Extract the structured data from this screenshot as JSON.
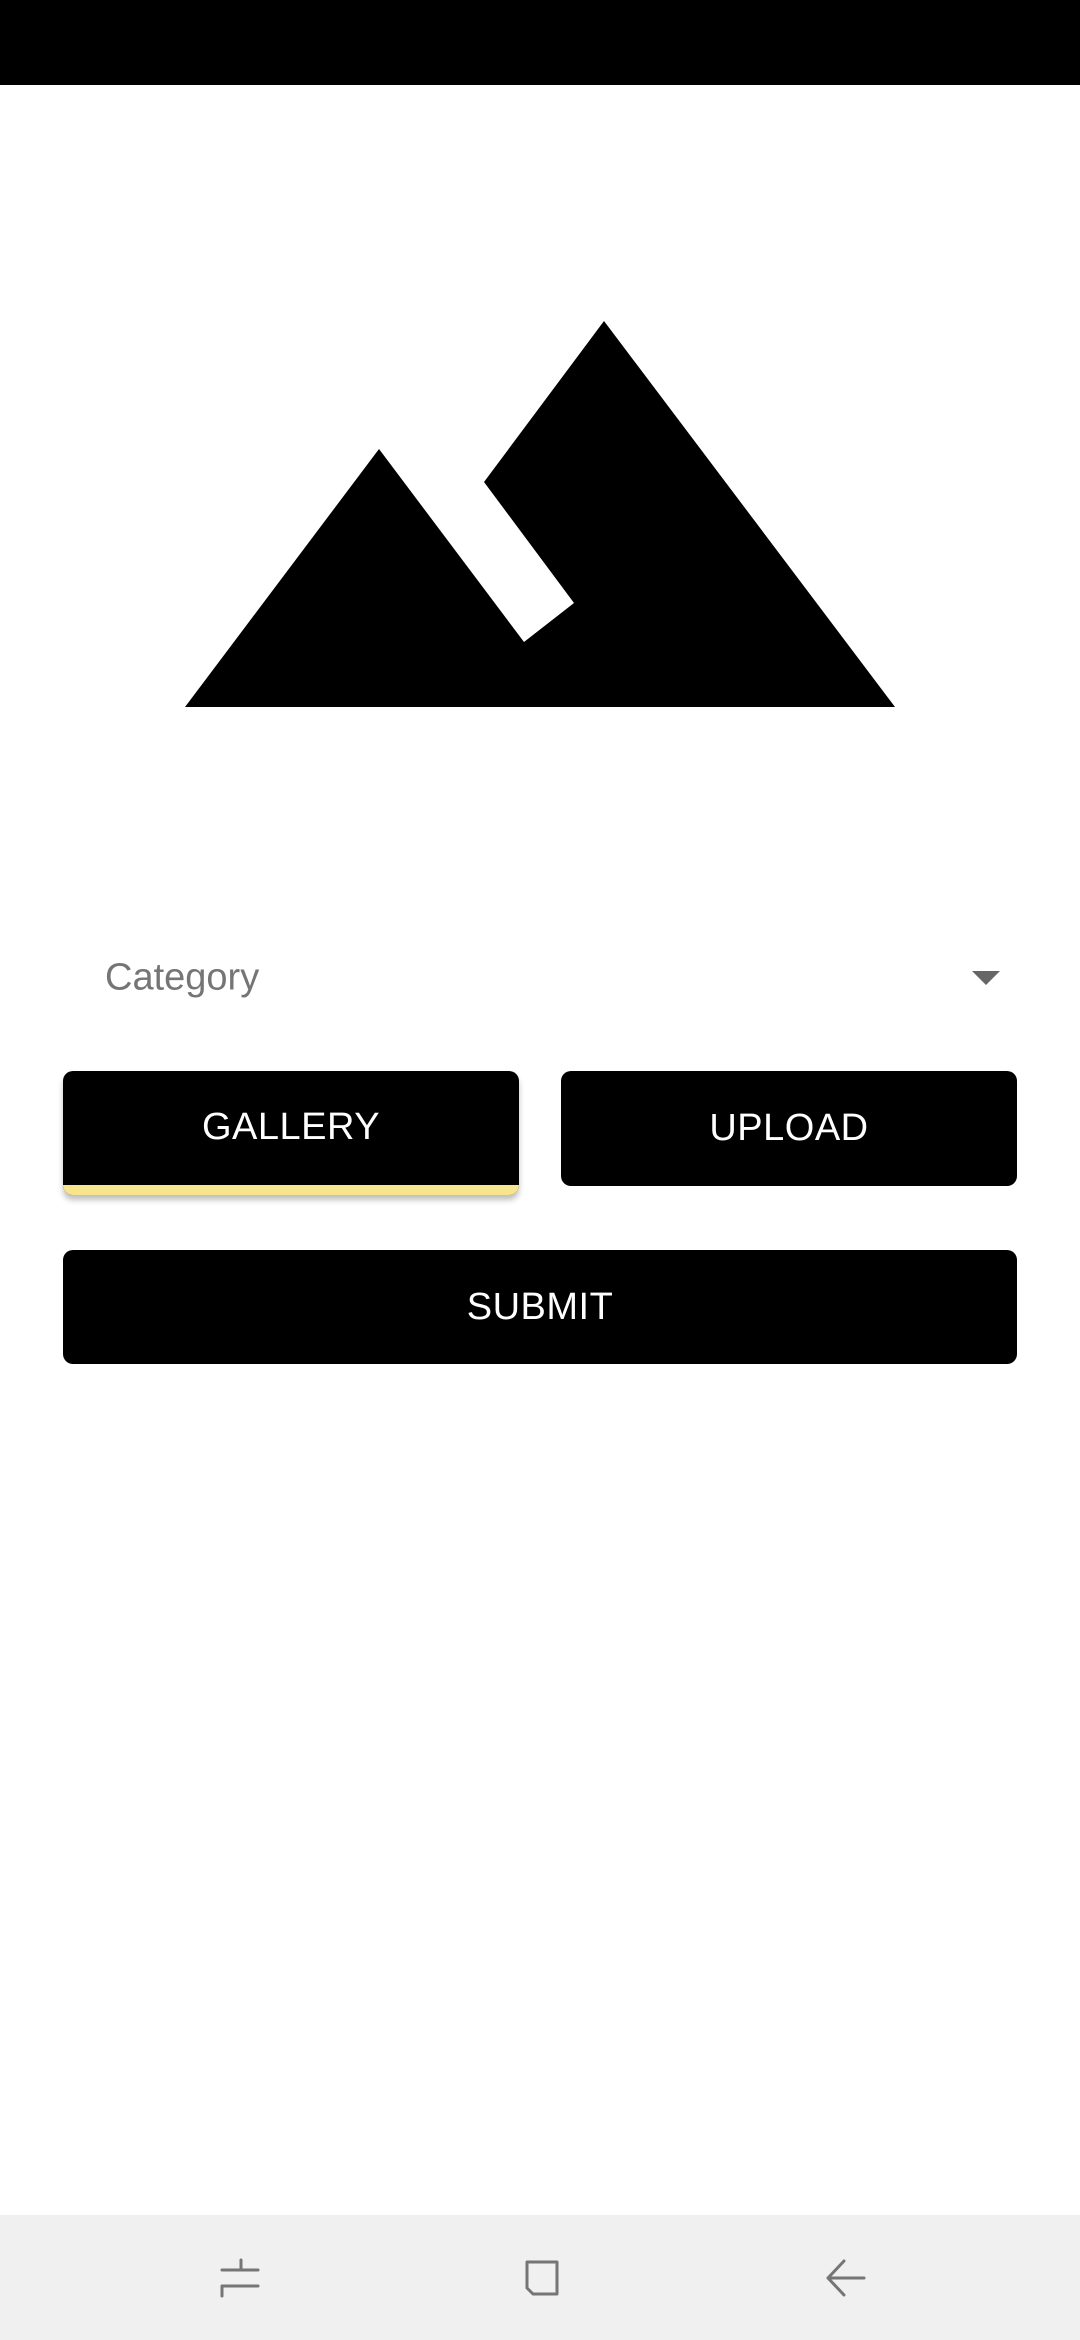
{
  "category_spinner": {
    "placeholder": "Category"
  },
  "buttons": {
    "gallery": "GALLERY",
    "upload": "UPLOAD",
    "submit": "SUBMIT"
  },
  "icons": {
    "image": "image-placeholder-icon",
    "dropdown": "dropdown-arrow-icon",
    "recents": "recents-icon",
    "home": "home-icon",
    "back": "back-icon"
  },
  "colors": {
    "primary": "#000000",
    "focus_highlight": "#f6e58d",
    "navbar_bg": "#f0f0f0"
  }
}
